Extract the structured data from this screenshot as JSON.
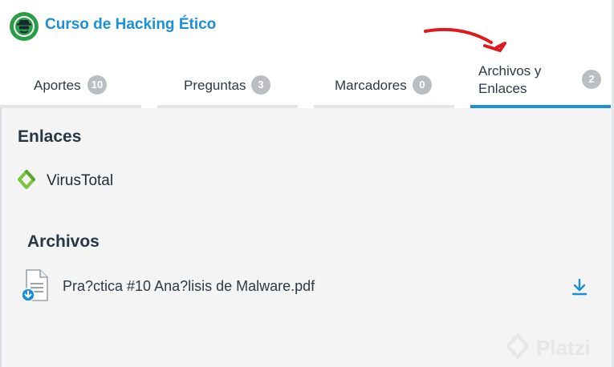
{
  "header": {
    "title": "Curso de Hacking Ético",
    "logo_icon": "hacker-logo-icon"
  },
  "tabs": [
    {
      "label": "Aportes",
      "count": "10",
      "active": false
    },
    {
      "label": "Preguntas",
      "count": "3",
      "active": false
    },
    {
      "label": "Marcadores",
      "count": "0",
      "active": false
    },
    {
      "label_line1": "Archivos y",
      "label_line2": "Enlaces",
      "count": "2",
      "active": true
    }
  ],
  "links": {
    "title": "Enlaces",
    "items": [
      {
        "label": "VirusTotal",
        "icon": "link-icon"
      }
    ]
  },
  "files": {
    "title": "Archivos",
    "items": [
      {
        "name": "Pra?ctica #10 Ana?lisis de Malware.pdf",
        "icon": "document-icon",
        "action_icon": "download-icon"
      }
    ]
  },
  "watermark": {
    "text": "Platzi"
  },
  "colors": {
    "accent": "#1c8fd9",
    "green": "#2a9d48",
    "annotation": "#e0191c"
  }
}
